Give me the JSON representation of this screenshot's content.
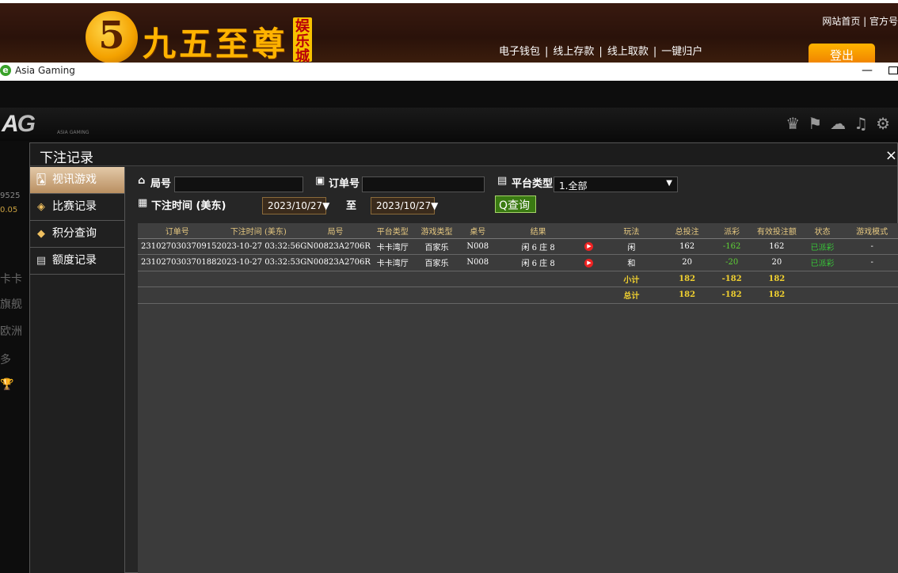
{
  "banner": {
    "logo_char": "5",
    "brand_name": "九五至尊",
    "brand_tag": "娱乐城",
    "wallet_links": [
      "电子钱包",
      "线上存款",
      "线上取款",
      "一键归户"
    ],
    "site_links": "网站首页 | 官方号",
    "logout": "登出"
  },
  "window": {
    "title": "Asia Gaming",
    "icon_char": "e",
    "min": "—"
  },
  "game": {
    "logo_a": "A",
    "logo_g": "G",
    "logo_sub": "ASIA GAMING",
    "icons": "♛⚑☁♫⚙",
    "ghost_texts": [
      "9525",
      "0.05",
      "卡卡",
      "旗舰",
      "欧洲",
      "多",
      "🏆"
    ]
  },
  "dialog": {
    "title": "下注记录",
    "close": "×",
    "menu": [
      {
        "label": "视讯游戏",
        "icon": "🂡",
        "active": true
      },
      {
        "label": "比赛记录",
        "icon": "◈"
      },
      {
        "label": "积分查询",
        "icon": "◆"
      },
      {
        "label": "额度记录",
        "icon": "▤"
      }
    ]
  },
  "filters": {
    "round_label": "局号",
    "order_label": "订单号",
    "platform_label": "平台类型",
    "platform_value": "1.全部",
    "time_label": "下注时间 (美东)",
    "date_from": "2023/10/27▼",
    "to": "至",
    "date_to": "2023/10/27▼",
    "query": "查询"
  },
  "table": {
    "headers": [
      "订单号",
      "下注时间 (美东)",
      "局号",
      "平台类型",
      "游戏类型",
      "桌号",
      "结果",
      "",
      "玩法",
      "总投注",
      "派彩",
      "有效投注额",
      "状态",
      "游戏模式"
    ],
    "rows": [
      [
        "231027030370915",
        "2023-10-27 03:32:56",
        "GN00823A2706R",
        "卡卡湾厅",
        "百家乐",
        "N008",
        "闲 6 庄 8",
        "▶",
        "闲",
        "162",
        "-162",
        "162",
        "已派彩",
        "-"
      ],
      [
        "231027030370188",
        "2023-10-27 03:32:53",
        "GN00823A2706R",
        "卡卡湾厅",
        "百家乐",
        "N008",
        "闲 6 庄 8",
        "▶",
        "和",
        "20",
        "-20",
        "20",
        "已派彩",
        "-"
      ]
    ],
    "subtotal": {
      "label": "小计",
      "bet": "182",
      "payout": "-182",
      "valid": "182"
    },
    "total": {
      "label": "总计",
      "bet": "182",
      "payout": "-182",
      "valid": "182"
    }
  }
}
